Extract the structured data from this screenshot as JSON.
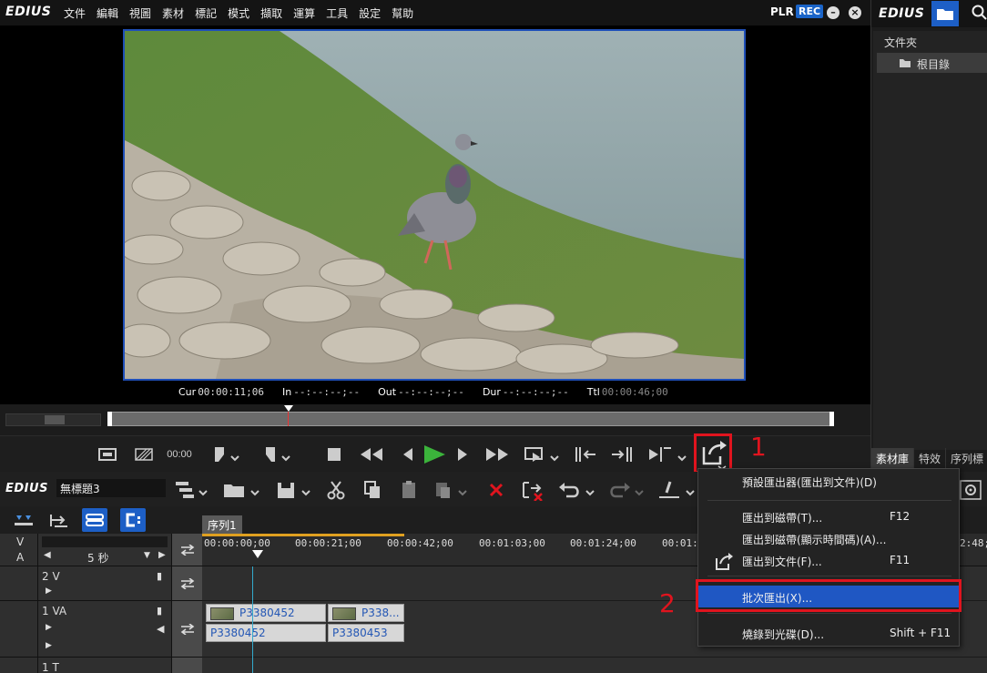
{
  "app": {
    "logo": "EDIUS",
    "menu": [
      "文件",
      "編輯",
      "視圖",
      "素材",
      "標記",
      "模式",
      "擷取",
      "運算",
      "工具",
      "設定",
      "幫助"
    ],
    "plr": "PLR",
    "rec": "REC"
  },
  "player": {
    "timecodes": [
      {
        "label": "Cur",
        "value": "00:00:11;06"
      },
      {
        "label": "In",
        "value": "--:--:--;--"
      },
      {
        "label": "Out",
        "value": "--:--:--;--"
      },
      {
        "label": "Dur",
        "value": "--:--:--;--"
      },
      {
        "label": "Ttl",
        "value": "00:00:46;00"
      }
    ],
    "zoom_label": "00:00"
  },
  "bin": {
    "logo": "EDIUS",
    "folder_header": "文件夾",
    "root": "根目錄",
    "tabs": [
      "素材庫",
      "特效",
      "序列標"
    ]
  },
  "timeline": {
    "logo": "EDIUS",
    "project_name": "無標題3",
    "sequence_tab": "序列1",
    "scale": "5 秒",
    "ruler_ticks": [
      "00:00:00;00",
      "00:00:21;00",
      "00:00:42;00",
      "00:01:03;00",
      "00:01:24;00",
      "00:01:4",
      "2:48;"
    ],
    "tracks": [
      {
        "label": "V"
      },
      {
        "label": "A"
      },
      {
        "label": "2 V"
      },
      {
        "label": "1 VA"
      },
      {
        "label": "1 T"
      }
    ],
    "clips": {
      "video": [
        "P3380452",
        "P338..."
      ],
      "audio": [
        "P3380452",
        "P3380453"
      ]
    }
  },
  "context_menu": {
    "items": [
      {
        "label": "預設匯出器(匯出到文件)(D)",
        "shortcut": ""
      },
      {
        "label": "匯出到磁帶(T)...",
        "shortcut": "F12"
      },
      {
        "label": "匯出到磁帶(顯示時間碼)(A)...",
        "shortcut": ""
      },
      {
        "label": "匯出到文件(F)...",
        "shortcut": "F11"
      },
      {
        "label": "批次匯出(X)...",
        "shortcut": ""
      },
      {
        "label": "燒錄到光碟(D)...",
        "shortcut": "Shift + F11"
      }
    ]
  },
  "annotations": {
    "step1": "1",
    "step2": "2"
  },
  "colors": {
    "accent_blue": "#1d5fc6",
    "highlight_red": "#e0141e",
    "menu_highlight": "#1f57c3"
  }
}
